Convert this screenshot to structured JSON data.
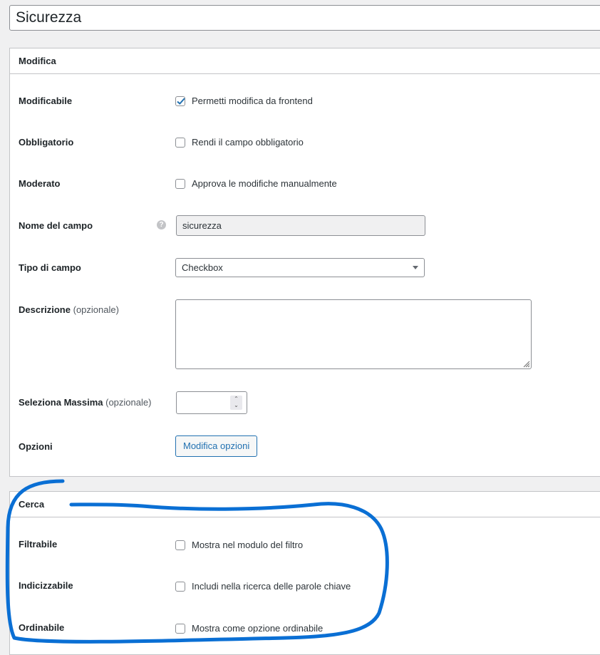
{
  "title_value": "Sicurezza",
  "modifica": {
    "heading": "Modifica",
    "modificabile": {
      "label": "Modificabile",
      "checkbox_label": "Permetti modifica da frontend",
      "checked": true
    },
    "obbligatorio": {
      "label": "Obbligatorio",
      "checkbox_label": "Rendi il campo obbligatorio",
      "checked": false
    },
    "moderato": {
      "label": "Moderato",
      "checkbox_label": "Approva le modifiche manualmente",
      "checked": false
    },
    "nome_campo": {
      "label": "Nome del campo",
      "help_glyph": "?",
      "value": "sicurezza"
    },
    "tipo_campo": {
      "label": "Tipo di campo",
      "selected": "Checkbox"
    },
    "descrizione": {
      "label": "Descrizione",
      "optional": "(opzionale)",
      "value": ""
    },
    "seleziona_massima": {
      "label": "Seleziona Massima",
      "optional": "(opzionale)",
      "value": ""
    },
    "opzioni": {
      "label": "Opzioni",
      "button": "Modifica opzioni"
    }
  },
  "cerca": {
    "heading": "Cerca",
    "filtrabile": {
      "label": "Filtrabile",
      "checkbox_label": "Mostra nel modulo del filtro",
      "checked": false
    },
    "indicizzabile": {
      "label": "Indicizzabile",
      "checkbox_label": "Includi nella ricerca delle parole chiave",
      "checked": false
    },
    "ordinabile": {
      "label": "Ordinabile",
      "checkbox_label": "Mostra come opzione ordinabile",
      "checked": false
    }
  },
  "colors": {
    "accent": "#2271b1",
    "annotation": "#0a6fd4",
    "checkmark": "#2271b1"
  }
}
